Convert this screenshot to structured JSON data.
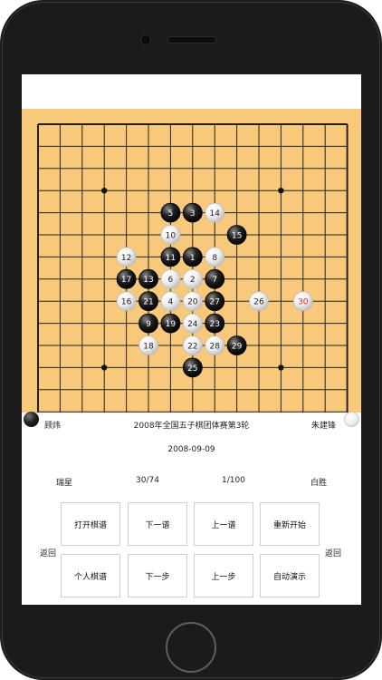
{
  "players": {
    "black": "顾炜",
    "white": "朱建锋"
  },
  "event": {
    "title": "2008年全国五子棋团体赛第3轮",
    "date": "2008-09-09"
  },
  "info": {
    "opening": "瑞星",
    "progress": "30/74",
    "page": "1/100",
    "result": "白胜"
  },
  "buttons": {
    "open": "打开棋谱",
    "next_record": "下一谱",
    "prev_record": "上一谱",
    "restart": "重新开始",
    "personal": "个人棋谱",
    "next_move": "下一步",
    "prev_move": "上一步",
    "auto_play": "自动演示",
    "back_left": "返回",
    "back_right": "返回"
  },
  "moves": [
    {
      "n": 1,
      "c": "black",
      "col": 7,
      "row": 6
    },
    {
      "n": 2,
      "c": "white",
      "col": 7,
      "row": 7
    },
    {
      "n": 3,
      "c": "black",
      "col": 7,
      "row": 4
    },
    {
      "n": 4,
      "c": "white",
      "col": 6,
      "row": 8
    },
    {
      "n": 5,
      "c": "black",
      "col": 6,
      "row": 4
    },
    {
      "n": 6,
      "c": "white",
      "col": 6,
      "row": 7
    },
    {
      "n": 7,
      "c": "black",
      "col": 8,
      "row": 7
    },
    {
      "n": 8,
      "c": "white",
      "col": 8,
      "row": 6
    },
    {
      "n": 9,
      "c": "black",
      "col": 5,
      "row": 9
    },
    {
      "n": 10,
      "c": "white",
      "col": 6,
      "row": 5
    },
    {
      "n": 11,
      "c": "black",
      "col": 6,
      "row": 6
    },
    {
      "n": 12,
      "c": "white",
      "col": 4,
      "row": 6
    },
    {
      "n": 13,
      "c": "black",
      "col": 5,
      "row": 7
    },
    {
      "n": 14,
      "c": "white",
      "col": 8,
      "row": 4
    },
    {
      "n": 15,
      "c": "black",
      "col": 9,
      "row": 5
    },
    {
      "n": 16,
      "c": "white",
      "col": 4,
      "row": 8
    },
    {
      "n": 17,
      "c": "black",
      "col": 4,
      "row": 7
    },
    {
      "n": 18,
      "c": "white",
      "col": 5,
      "row": 10
    },
    {
      "n": 19,
      "c": "black",
      "col": 6,
      "row": 9
    },
    {
      "n": 20,
      "c": "white",
      "col": 7,
      "row": 8
    },
    {
      "n": 21,
      "c": "black",
      "col": 5,
      "row": 8
    },
    {
      "n": 22,
      "c": "white",
      "col": 7,
      "row": 10
    },
    {
      "n": 23,
      "c": "black",
      "col": 8,
      "row": 9
    },
    {
      "n": 24,
      "c": "white",
      "col": 7,
      "row": 9
    },
    {
      "n": 25,
      "c": "black",
      "col": 7,
      "row": 11
    },
    {
      "n": 26,
      "c": "white",
      "col": 10,
      "row": 8
    },
    {
      "n": 27,
      "c": "black",
      "col": 8,
      "row": 8
    },
    {
      "n": 28,
      "c": "white",
      "col": 8,
      "row": 10
    },
    {
      "n": 29,
      "c": "black",
      "col": 9,
      "row": 10
    },
    {
      "n": 30,
      "c": "white",
      "col": 12,
      "row": 8,
      "last": true
    }
  ]
}
